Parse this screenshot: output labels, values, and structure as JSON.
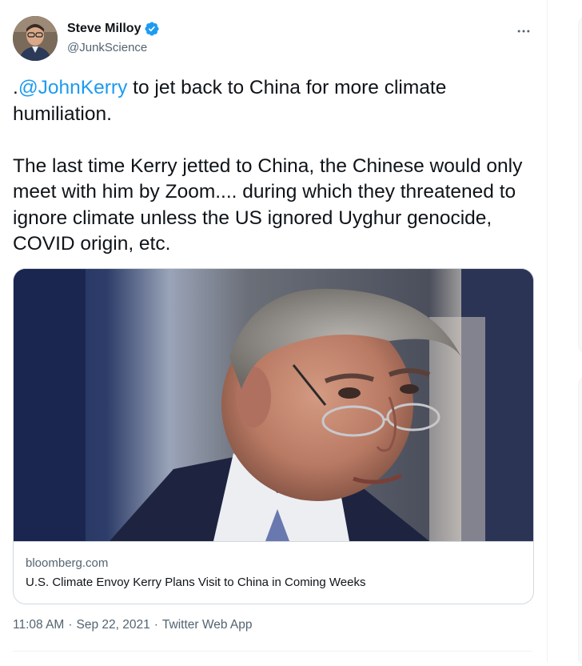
{
  "author": {
    "display_name": "Steve Milloy",
    "handle": "@JunkScience",
    "verified": true
  },
  "tweet": {
    "prefix": ".",
    "mention": "@JohnKerry",
    "line1_rest": " to jet back to China for more climate humiliation.",
    "paragraph2": "The last time Kerry jetted to China, the Chinese would only meet with him by Zoom.... during which they threatened to ignore climate unless the US ignored Uyghur genocide, COVID origin, etc."
  },
  "card": {
    "domain": "bloomberg.com",
    "title": "U.S. Climate Envoy Kerry Plans Visit to China in Coming Weeks"
  },
  "meta": {
    "time": "11:08 AM",
    "separator": "·",
    "date": "Sep 22, 2021",
    "source": "Twitter Web App"
  },
  "icons": {
    "verified": "verified-badge-icon",
    "more": "more-horizontal-icon"
  },
  "colors": {
    "accent": "#1d9bf0",
    "text": "#0f1419",
    "secondary": "#536471",
    "border": "#cfd9de"
  }
}
